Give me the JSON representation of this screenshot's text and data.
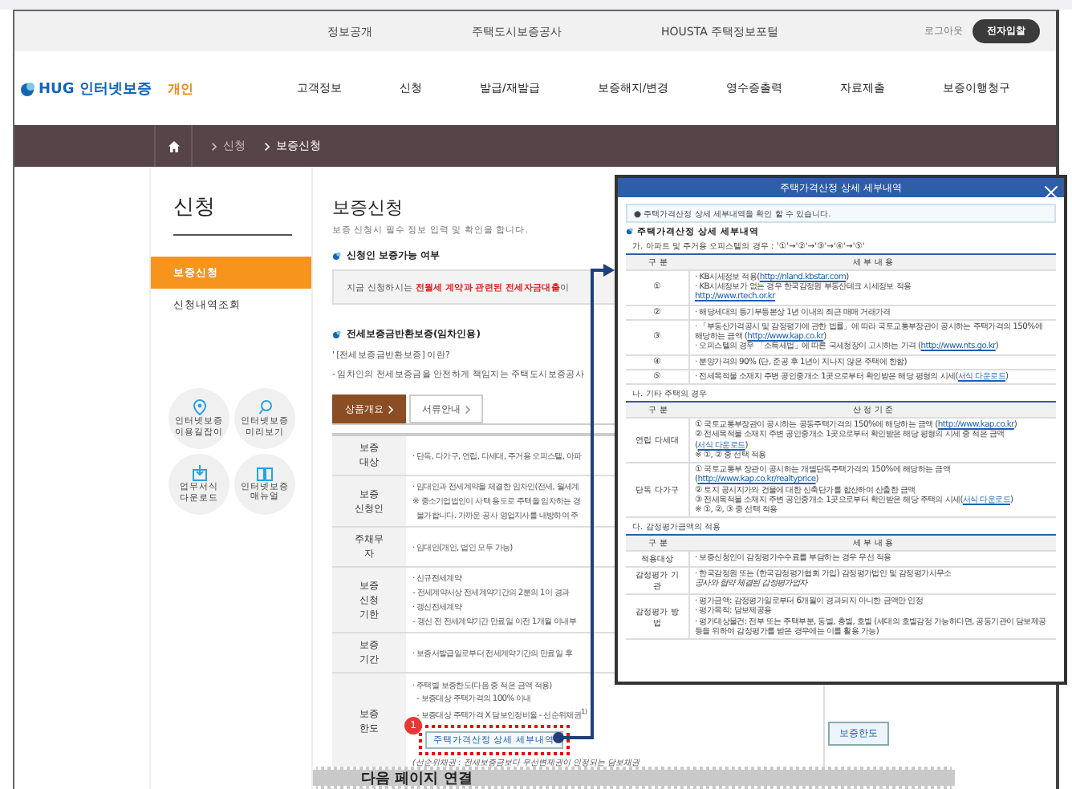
{
  "top_links": [
    "정보공개",
    "주택도시보증공사",
    "HOUSTA 주택정보포털"
  ],
  "logout": "로그아웃",
  "bid_button": "전자입찰",
  "logo": {
    "brand": "HUG 인터넷보증",
    "mode": "개인"
  },
  "nav": [
    "고객정보",
    "신청",
    "발급/재발급",
    "보증해지/변경",
    "영수증출력",
    "자료제출",
    "보증이행청구"
  ],
  "breadcrumb": [
    "신청",
    "보증신청"
  ],
  "sidebar": {
    "title": "신청",
    "items": [
      {
        "label": "보증신청",
        "selected": true
      },
      {
        "label": "신청내역조회",
        "selected": false
      }
    ],
    "shortcuts": [
      {
        "kind": "pin",
        "label": "인터넷보증 이용길잡이"
      },
      {
        "kind": "search",
        "label": "인터넷보증 미리보기"
      },
      {
        "kind": "download",
        "label": "업무서식 다운로드"
      },
      {
        "kind": "book",
        "label": "인터넷보증 매뉴얼"
      }
    ]
  },
  "main": {
    "title": "보증신청",
    "subtitle": "보증 신청시 필수 정보 입력 및 확인을 합니다.",
    "section1": "신청인 보증가능 여부",
    "notice": "지금 신청하시는 **전월세 계약과 관련된 전세자금대출**이",
    "section2": "전세보증금반환보증(임차인용)",
    "def_title": "' [전세보증금반환보증] 이란?",
    "def_text": "- 임차인의 전세보증금을 안전하게 책임지는 주택도시보증공사",
    "tabs": [
      {
        "label": "상품개요",
        "selected": true
      },
      {
        "label": "서류안내",
        "selected": false
      }
    ],
    "rows": [
      {
        "head": "보증 대상",
        "lines": [
          "· 단독, 다가구, 연립, 다세대, 주거용 오피스텔, 아파"
        ]
      },
      {
        "head": "보증 신청인",
        "lines": [
          "· 임대인과 전세계약을 체결한 임차인(전세, 월세계",
          "※ 중소기업법인이 사택 용도로 주택을 임차하는 경",
          "  불가합니다. 가까운 공사 영업지사를 내방하여 주"
        ]
      },
      {
        "head": "주채무자",
        "lines": [
          "· 임대인(개인, 법인 모두 가능)"
        ]
      },
      {
        "head": "보증 신청 기한",
        "lines": [
          "· 신규전세계약",
          "- 전세계약서상 전세계약기간의 2분의 1이 경과",
          "· 갱신전세계약",
          "- 갱신 전 전세계약기간 만료일 이전 1개월 이내부"
        ]
      },
      {
        "head": "보증 기간",
        "lines": [
          "· 보증서발급일로부터 전세계약기간의 만료일 후"
        ]
      }
    ],
    "limit": {
      "head": "보증 한도",
      "lines": [
        "· 주택별 보증한도(다음 중 적은 금액 적용)",
        "  - 보증대상 주택가격의 100% 이내",
        "  - 보증대상 주택가격 X 담보인정비율 - 선순위채권$^{1)}$"
      ],
      "detail_button": "주택가격산정 상세 세부내역",
      "note": "(선순위채권 : 전세보증금보다 우선변제권이 인정되는 담보채권",
      "limit_button": "보증한도"
    },
    "badge": "1",
    "next_page": "다음 페이지 연결"
  },
  "popup": {
    "title": "주택가격산정 상세 세부내역",
    "info": "● 주택가격산정 상세 세부내역을 확인 할 수 있습니다.",
    "heading": "주택가격산정 상세 세부내역",
    "sections": [
      {
        "caption": "가. 아파트 및 주거용 오피스텔의 경우 : '①'→'②'→'③'→'④'→'⑤'",
        "columns": [
          "구 분",
          "세 부 내 용"
        ],
        "rows": [
          {
            "head": "①",
            "lines": [
              {
                "text": "· KB시세정보 적용(",
                "link": "http://nland.kbstar.com",
                "after": ")"
              },
              {
                "text": "· KB시세정보가 없는 경우 한국감정원 부동산테크 시세정보 적용"
              },
              {
                "link": "http://www.rtech.or.kr"
              }
            ]
          },
          {
            "head": "②",
            "lines": [
              {
                "text": "· 해당세대의 등기부등본상 1년 이내의 최근 매매 거래가격"
              }
            ]
          },
          {
            "head": "③",
            "lines": [
              {
                "text": "· 「부동산가격공시 및 감정평가에 관한 법률」에 따라 국토교통부장관이 공시하는 주택가격의 150%에 해당하는 금액 (",
                "link": "http://www.kap.co.kr",
                "after": ")"
              },
              {
                "text": "· 오피스텔의 경우 「소득세법」에 따른 국세청장이 고시하는 가격 (",
                "link": "http://www.nts.go.kr",
                "after": ")"
              }
            ]
          },
          {
            "head": "④",
            "lines": [
              {
                "text": "· 분양가격의 90% (단, 준공 후 1년이 지나지 않은 주택에 한함)"
              }
            ]
          },
          {
            "head": "⑤",
            "lines": [
              {
                "text": "· 전세목적물 소재지 주변 공인중개소 1곳으로부터 확인받은 해당 평형의 시세(",
                "link": "서식 다운로드",
                "after": ")"
              }
            ]
          }
        ]
      },
      {
        "caption": "나. 기타 주택의 경우",
        "columns": [
          "구 분",
          "산 정 기 준"
        ],
        "rows": [
          {
            "head": "연립 다세대",
            "lines": [
              {
                "text": "① 국토교통부장관이 공시하는 공동주택가격의 150%에 해당하는 금액 (",
                "link": "http://www.kap.co.kr",
                "after": ")"
              },
              {
                "text": "② 전세목적물 소재지 주변 공인중개소 1곳으로부터 확인받은 해당 평형의 시세 중 적은 금액(",
                "link": "서식 다운로드",
                "after": ")"
              },
              {
                "text": "※ ①, ② 중 선택 적용"
              }
            ]
          },
          {
            "head": "단독 다가구",
            "lines": [
              {
                "text": "① 국토교통부 장관이 공시하는 개별단독주택가격의 150%에 해당하는 금액 (",
                "link": "http://www.kap.co.kr/realtyprice",
                "after": ")"
              },
              {
                "text": "② 토지 공시지가와 건물에 대한 신축단가를 합산하여 산출한 금액"
              },
              {
                "text": "③ 전세목적물 소재지 주변 공인중개소 1곳으로부터 확인받은 해당 주택의 시세(",
                "link": "서식 다운로드",
                "after": ")"
              },
              {
                "text": "※ ①, ②, ③ 중 선택 적용"
              }
            ]
          }
        ]
      },
      {
        "caption": "다. 감정평가금액의 적용",
        "columns": [
          "구 분",
          "세 부 내 용"
        ],
        "rows": [
          {
            "head": "적용대상",
            "lines": [
              {
                "text": "· 보증신청인이 감정평가수수료를 부담하는 경우 우선 적용"
              }
            ]
          },
          {
            "head": "감정평가 기관",
            "lines": [
              {
                "text": "· 한국감정원 또는 (한국감정평가협회 가입) 감정평가법인 및 감정평가사무소"
              },
              {
                "text": "*공사와 협약 체결된 감정평가업자*"
              }
            ]
          },
          {
            "head": "감정평가 방법",
            "lines": [
              {
                "text": "· 평가금액: 감정평가일로부터 6개월이 경과되지 아니한 금액만 인정"
              },
              {
                "text": "· 평가목적: 담보제공용"
              },
              {
                "text": "· 평가대상물건: 전부 또는 주택부분, 동별, 층별, 호별 (세대의 호별감정 가능하다면, 공동기관이 담보제공 등을 위하여 감정평가를 받은 경우에는 이를 활용 가능)"
              }
            ]
          }
        ]
      }
    ]
  }
}
